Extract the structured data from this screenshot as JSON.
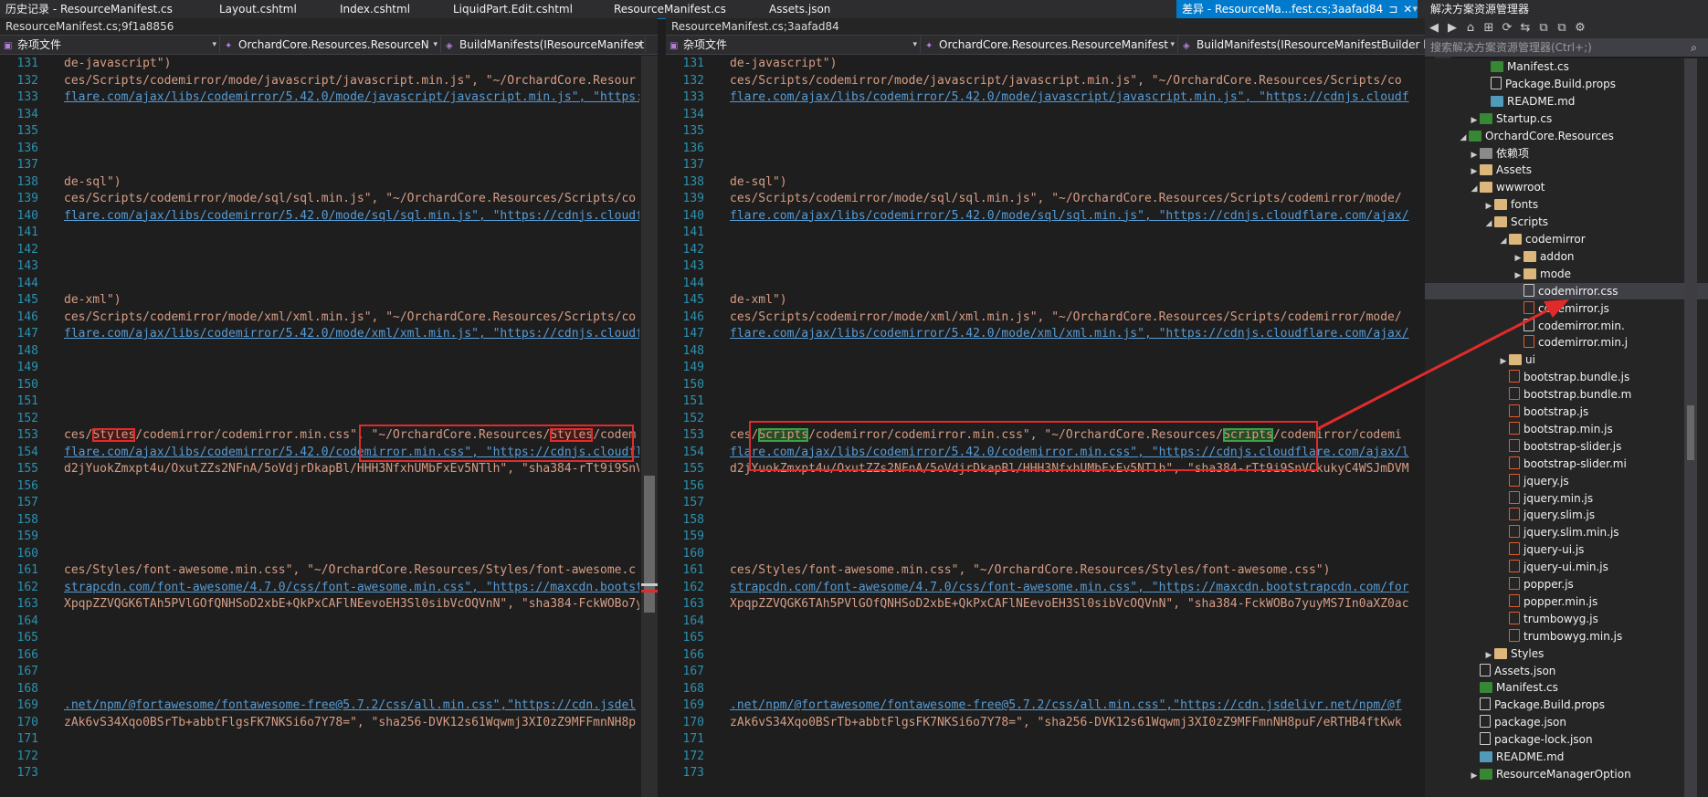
{
  "tabs": [
    {
      "label": "历史记录 - ResourceManifest.cs",
      "active": false
    },
    {
      "label": "Layout.cshtml",
      "active": false
    },
    {
      "label": "Index.cshtml",
      "active": false
    },
    {
      "label": "LiquidPart.Edit.cshtml",
      "active": false
    },
    {
      "label": "ResourceManifest.cs",
      "active": false
    },
    {
      "label": "Assets.json",
      "active": false
    },
    {
      "label": "差异 - ResourceMa...fest.cs;3aafad84",
      "active": true
    }
  ],
  "tab_close_glyph": "✕",
  "tab_pin_glyph": "⊐",
  "tabbar_dropdown": "▾",
  "left_pane": {
    "title": "ResourceManifest.cs;9f1a8856",
    "nav": [
      "杂项文件",
      "OrchardCore.Resources.ResourceN",
      "BuildManifests(IResourceManifestB"
    ]
  },
  "right_pane": {
    "title": "ResourceManifest.cs;3aafad84",
    "nav": [
      "杂项文件",
      "OrchardCore.Resources.ResourceManifest",
      "BuildManifests(IResourceManifestBuilder b"
    ]
  },
  "left_lines": [
    {
      "n": "131",
      "t": "de-javascript\")",
      "k": "s"
    },
    {
      "n": "132",
      "t": "ces/Scripts/codemirror/mode/javascript/javascript.min.js\", \"~/OrchardCore.Resour",
      "k": "s"
    },
    {
      "n": "133",
      "t": "flare.com/ajax/libs/codemirror/5.42.0/mode/javascript/javascript.min.js\", \"https:",
      "k": "u"
    },
    {
      "n": "134",
      "t": "",
      "k": "s"
    },
    {
      "n": "135",
      "t": "",
      "k": "s"
    },
    {
      "n": "136",
      "t": "",
      "k": "s"
    },
    {
      "n": "137",
      "t": "",
      "k": "s"
    },
    {
      "n": "138",
      "t": "de-sql\")",
      "k": "s"
    },
    {
      "n": "139",
      "t": "ces/Scripts/codemirror/mode/sql/sql.min.js\", \"~/OrchardCore.Resources/Scripts/co",
      "k": "s"
    },
    {
      "n": "140",
      "t": "flare.com/ajax/libs/codemirror/5.42.0/mode/sql/sql.min.js\", \"https://cdnjs.cloudf",
      "k": "u"
    },
    {
      "n": "141",
      "t": "",
      "k": "s"
    },
    {
      "n": "142",
      "t": "",
      "k": "s"
    },
    {
      "n": "143",
      "t": "",
      "k": "s"
    },
    {
      "n": "144",
      "t": "",
      "k": "s"
    },
    {
      "n": "145",
      "t": "de-xml\")",
      "k": "s"
    },
    {
      "n": "146",
      "t": "ces/Scripts/codemirror/mode/xml/xml.min.js\", \"~/OrchardCore.Resources/Scripts/co",
      "k": "s"
    },
    {
      "n": "147",
      "t": "flare.com/ajax/libs/codemirror/5.42.0/mode/xml/xml.min.js\", \"https://cdnjs.cloudf",
      "k": "u"
    },
    {
      "n": "148",
      "t": "",
      "k": "s"
    },
    {
      "n": "149",
      "t": "",
      "k": "s"
    },
    {
      "n": "150",
      "t": "",
      "k": "s"
    },
    {
      "n": "151",
      "t": "",
      "k": "s"
    },
    {
      "n": "152",
      "t": "",
      "k": "s"
    },
    {
      "n": "153",
      "t": "ces/Styles/codemirror/codemirror.min.css\", \"~/OrchardCore.Resources/Styles/codem",
      "k": "del"
    },
    {
      "n": "154",
      "t": "flare.com/ajax/libs/codemirror/5.42.0/codemirror.min.css\", \"https://cdnjs.cloudfl",
      "k": "u"
    },
    {
      "n": "155",
      "t": "d2jYuokZmxpt4u/OxutZZs2NFnA/5oVdjrDkapBl/HHH3NfxhUMbFxEv5NTlh\", \"sha384-rTt9i9SnV",
      "k": "s"
    },
    {
      "n": "156",
      "t": "",
      "k": "s"
    },
    {
      "n": "157",
      "t": "",
      "k": "s"
    },
    {
      "n": "158",
      "t": "",
      "k": "s"
    },
    {
      "n": "159",
      "t": "",
      "k": "s"
    },
    {
      "n": "160",
      "t": "",
      "k": "s"
    },
    {
      "n": "161",
      "t": "ces/Styles/font-awesome.min.css\", \"~/OrchardCore.Resources/Styles/font-awesome.c",
      "k": "s"
    },
    {
      "n": "162",
      "t": "strapcdn.com/font-awesome/4.7.0/css/font-awesome.min.css\", \"https://maxcdn.bootst",
      "k": "u"
    },
    {
      "n": "163",
      "t": "XpqpZZVQGK6TAh5PVlGOfQNHSoD2xbE+QkPxCAFlNEevoEH3Sl0sibVcOQVnN\", \"sha384-FckWOBo7y",
      "k": "s"
    },
    {
      "n": "164",
      "t": "",
      "k": "s"
    },
    {
      "n": "165",
      "t": "",
      "k": "s"
    },
    {
      "n": "166",
      "t": "",
      "k": "s"
    },
    {
      "n": "167",
      "t": "",
      "k": "s"
    },
    {
      "n": "168",
      "t": "",
      "k": "s"
    },
    {
      "n": "169",
      "t": ".net/npm/@fortawesome/fontawesome-free@5.7.2/css/all.min.css\",\"https://cdn.jsdel",
      "k": "u"
    },
    {
      "n": "170",
      "t": "zAk6vS34Xqo0BSrTb+abbtFlgsFK7NKSi6o7Y78=\", \"sha256-DVK12s61Wqwmj3XI0zZ9MFFmnNH8p",
      "k": "s"
    },
    {
      "n": "171",
      "t": "",
      "k": "s"
    },
    {
      "n": "172",
      "t": "",
      "k": "s"
    },
    {
      "n": "173",
      "t": "",
      "k": "s"
    }
  ],
  "right_lines": [
    {
      "n": "131",
      "t": "de-javascript\")",
      "k": "s"
    },
    {
      "n": "132",
      "t": "ces/Scripts/codemirror/mode/javascript/javascript.min.js\", \"~/OrchardCore.Resources/Scripts/co",
      "k": "s"
    },
    {
      "n": "133",
      "t": "flare.com/ajax/libs/codemirror/5.42.0/mode/javascript/javascript.min.js\", \"https://cdnjs.cloudf",
      "k": "u"
    },
    {
      "n": "134",
      "t": "",
      "k": "s"
    },
    {
      "n": "135",
      "t": "",
      "k": "s"
    },
    {
      "n": "136",
      "t": "",
      "k": "s"
    },
    {
      "n": "137",
      "t": "",
      "k": "s"
    },
    {
      "n": "138",
      "t": "de-sql\")",
      "k": "s"
    },
    {
      "n": "139",
      "t": "ces/Scripts/codemirror/mode/sql/sql.min.js\", \"~/OrchardCore.Resources/Scripts/codemirror/mode/",
      "k": "s"
    },
    {
      "n": "140",
      "t": "flare.com/ajax/libs/codemirror/5.42.0/mode/sql/sql.min.js\", \"https://cdnjs.cloudflare.com/ajax/",
      "k": "u"
    },
    {
      "n": "141",
      "t": "",
      "k": "s"
    },
    {
      "n": "142",
      "t": "",
      "k": "s"
    },
    {
      "n": "143",
      "t": "",
      "k": "s"
    },
    {
      "n": "144",
      "t": "",
      "k": "s"
    },
    {
      "n": "145",
      "t": "de-xml\")",
      "k": "s"
    },
    {
      "n": "146",
      "t": "ces/Scripts/codemirror/mode/xml/xml.min.js\", \"~/OrchardCore.Resources/Scripts/codemirror/mode/",
      "k": "s"
    },
    {
      "n": "147",
      "t": "flare.com/ajax/libs/codemirror/5.42.0/mode/xml/xml.min.js\", \"https://cdnjs.cloudflare.com/ajax/",
      "k": "u"
    },
    {
      "n": "148",
      "t": "",
      "k": "s"
    },
    {
      "n": "149",
      "t": "",
      "k": "s"
    },
    {
      "n": "150",
      "t": "",
      "k": "s"
    },
    {
      "n": "151",
      "t": "",
      "k": "s"
    },
    {
      "n": "152",
      "t": "",
      "k": "s"
    },
    {
      "n": "153",
      "t": "ces/Scripts/codemirror/codemirror.min.css\", \"~/OrchardCore.Resources/Scripts/codemirror/codemi",
      "k": "add"
    },
    {
      "n": "154",
      "t": "flare.com/ajax/libs/codemirror/5.42.0/codemirror.min.css\", \"https://cdnjs.cloudflare.com/ajax/l",
      "k": "u"
    },
    {
      "n": "155",
      "t": "d2jYuokZmxpt4u/OxutZZs2NFnA/5oVdjrDkapBl/HHH3NfxhUMbFxEv5NTlh\", \"sha384-rTt9i9SnVCkukyC4WSJmDVM",
      "k": "s"
    },
    {
      "n": "156",
      "t": "",
      "k": "s"
    },
    {
      "n": "157",
      "t": "",
      "k": "s"
    },
    {
      "n": "158",
      "t": "",
      "k": "s"
    },
    {
      "n": "159",
      "t": "",
      "k": "s"
    },
    {
      "n": "160",
      "t": "",
      "k": "s"
    },
    {
      "n": "161",
      "t": "ces/Styles/font-awesome.min.css\", \"~/OrchardCore.Resources/Styles/font-awesome.css\")",
      "k": "s"
    },
    {
      "n": "162",
      "t": "strapcdn.com/font-awesome/4.7.0/css/font-awesome.min.css\", \"https://maxcdn.bootstrapcdn.com/for",
      "k": "u"
    },
    {
      "n": "163",
      "t": "XpqpZZVQGK6TAh5PVlGOfQNHSoD2xbE+QkPxCAFlNEevoEH3Sl0sibVcOQVnN\", \"sha384-FckWOBo7yuyMS7In0aXZ0ac",
      "k": "s"
    },
    {
      "n": "164",
      "t": "",
      "k": "s"
    },
    {
      "n": "165",
      "t": "",
      "k": "s"
    },
    {
      "n": "166",
      "t": "",
      "k": "s"
    },
    {
      "n": "167",
      "t": "",
      "k": "s"
    },
    {
      "n": "168",
      "t": "",
      "k": "s"
    },
    {
      "n": "169",
      "t": ".net/npm/@fortawesome/fontawesome-free@5.7.2/css/all.min.css\",\"https://cdn.jsdelivr.net/npm/@f",
      "k": "u"
    },
    {
      "n": "170",
      "t": "zAk6vS34Xqo0BSrTb+abbtFlgsFK7NKSi6o7Y78=\", \"sha256-DVK12s61Wqwmj3XI0zZ9MFFmnNH8puF/eRTHB4ftKwk",
      "k": "s"
    },
    {
      "n": "171",
      "t": "",
      "k": "s"
    },
    {
      "n": "172",
      "t": "",
      "k": "s"
    },
    {
      "n": "173",
      "t": "",
      "k": "s"
    }
  ],
  "diff": {
    "removed_word": "Styles",
    "added_word": "Scripts"
  },
  "solution_explorer": {
    "title": "解决方案资源管理器",
    "toolbar_icons": [
      "◀",
      "▶",
      "⌂",
      "⊞",
      "⟳",
      "⇆",
      "⧉",
      "⧉",
      "⚙"
    ],
    "search_placeholder": "搜索解决方案资源管理器(Ctrl+;)",
    "search_icon": "⌕",
    "nodes": [
      {
        "label": "Manifest.cs",
        "icon": "cs",
        "exp": ""
      },
      {
        "label": "Package.Build.props",
        "icon": "file",
        "exp": ""
      },
      {
        "label": "README.md",
        "icon": "md",
        "exp": ""
      },
      {
        "label": "Startup.cs",
        "icon": "cs",
        "exp": "▶"
      },
      {
        "label": "OrchardCore.Resources",
        "icon": "proj",
        "exp": "◢"
      },
      {
        "label": "依赖项",
        "icon": "ref",
        "exp": "▶"
      },
      {
        "label": "Assets",
        "icon": "folder",
        "exp": "▶"
      },
      {
        "label": "wwwroot",
        "icon": "folder",
        "exp": "◢"
      },
      {
        "label": "fonts",
        "icon": "folder",
        "exp": "▶"
      },
      {
        "label": "Scripts",
        "icon": "folder",
        "exp": "◢"
      },
      {
        "label": "codemirror",
        "icon": "folder",
        "exp": "◢"
      },
      {
        "label": "addon",
        "icon": "folder",
        "exp": "▶"
      },
      {
        "label": "mode",
        "icon": "folder",
        "exp": "▶"
      },
      {
        "label": "codemirror.css",
        "icon": "file",
        "exp": "",
        "selected": true
      },
      {
        "label": "codemirror.js",
        "icon": "js",
        "exp": ""
      },
      {
        "label": "codemirror.min.",
        "icon": "file",
        "exp": ""
      },
      {
        "label": "codemirror.min.j",
        "icon": "js",
        "exp": ""
      },
      {
        "label": "ui",
        "icon": "folder",
        "exp": "▶"
      },
      {
        "label": "bootstrap.bundle.js",
        "icon": "js",
        "exp": ""
      },
      {
        "label": "bootstrap.bundle.m",
        "icon": "js",
        "exp": ""
      },
      {
        "label": "bootstrap.js",
        "icon": "js",
        "exp": ""
      },
      {
        "label": "bootstrap.min.js",
        "icon": "js",
        "exp": ""
      },
      {
        "label": "bootstrap-slider.js",
        "icon": "js",
        "exp": ""
      },
      {
        "label": "bootstrap-slider.mi",
        "icon": "js",
        "exp": ""
      },
      {
        "label": "jquery.js",
        "icon": "js",
        "exp": ""
      },
      {
        "label": "jquery.min.js",
        "icon": "js",
        "exp": ""
      },
      {
        "label": "jquery.slim.js",
        "icon": "js",
        "exp": ""
      },
      {
        "label": "jquery.slim.min.js",
        "icon": "js",
        "exp": ""
      },
      {
        "label": "jquery-ui.js",
        "icon": "js",
        "exp": ""
      },
      {
        "label": "jquery-ui.min.js",
        "icon": "js",
        "exp": ""
      },
      {
        "label": "popper.js",
        "icon": "js",
        "exp": ""
      },
      {
        "label": "popper.min.js",
        "icon": "js",
        "exp": ""
      },
      {
        "label": "trumbowyg.js",
        "icon": "js",
        "exp": ""
      },
      {
        "label": "trumbowyg.min.js",
        "icon": "js",
        "exp": ""
      },
      {
        "label": "Styles",
        "icon": "folder",
        "exp": "▶"
      },
      {
        "label": "Assets.json",
        "icon": "file",
        "exp": ""
      },
      {
        "label": "Manifest.cs",
        "icon": "cs",
        "exp": ""
      },
      {
        "label": "Package.Build.props",
        "icon": "file",
        "exp": ""
      },
      {
        "label": "package.json",
        "icon": "file",
        "exp": ""
      },
      {
        "label": "package-lock.json",
        "icon": "file",
        "exp": ""
      },
      {
        "label": "README.md",
        "icon": "md",
        "exp": ""
      },
      {
        "label": "ResourceManagerOption",
        "icon": "cs",
        "exp": "▶"
      }
    ]
  },
  "colors": {
    "accent": "#007acc",
    "annotation_red": "#e12b2b",
    "diff_removed_bg": "#4b1818",
    "diff_added_bg": "#274f24",
    "string": "#d69d85",
    "link": "#569cd6",
    "line_number": "#2b91af"
  }
}
